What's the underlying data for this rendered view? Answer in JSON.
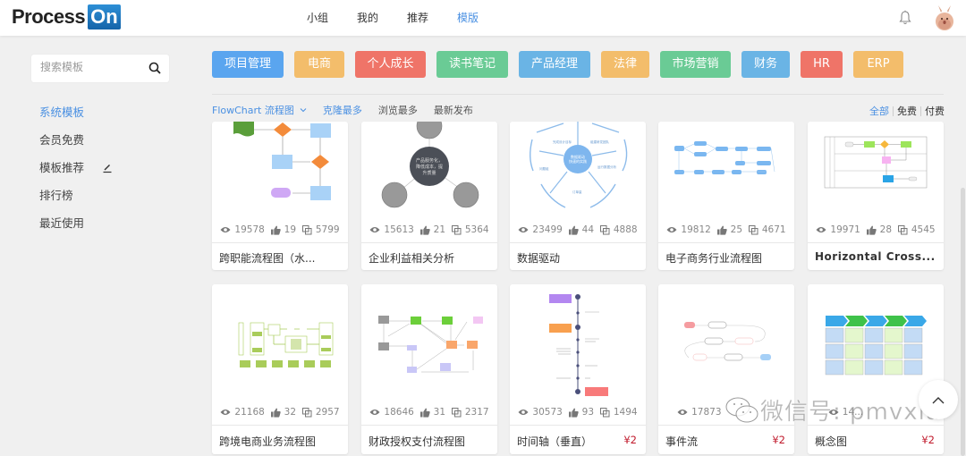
{
  "app": {
    "logo_word": "Process",
    "logo_on": "On"
  },
  "nav": [
    {
      "label": "小组",
      "active": false
    },
    {
      "label": "我的",
      "active": false
    },
    {
      "label": "推荐",
      "active": false
    },
    {
      "label": "模版",
      "active": true
    }
  ],
  "header_icons": {
    "notification": "bell-icon",
    "avatar": "user-avatar"
  },
  "search": {
    "placeholder": "搜索模板",
    "value": "",
    "icon": "search-icon"
  },
  "sidebar": {
    "items": [
      {
        "label": "系统模板",
        "active": true
      },
      {
        "label": "会员免费",
        "active": false
      },
      {
        "label": "模板推荐",
        "active": false,
        "icon": "edit-pen-icon"
      },
      {
        "label": "排行榜",
        "active": false
      },
      {
        "label": "最近使用",
        "active": false
      }
    ]
  },
  "categories": [
    {
      "label": "项目管理",
      "color": "#5aa5ef"
    },
    {
      "label": "电商",
      "color": "#f3bd6b"
    },
    {
      "label": "个人成长",
      "color": "#ef7468"
    },
    {
      "label": "读书笔记",
      "color": "#6acb95"
    },
    {
      "label": "产品经理",
      "color": "#6ab4e5"
    },
    {
      "label": "法律",
      "color": "#f3bd6b"
    },
    {
      "label": "市场营销",
      "color": "#6acb95"
    },
    {
      "label": "财务",
      "color": "#6ab4e5"
    },
    {
      "label": "HR",
      "color": "#ef7468"
    },
    {
      "label": "ERP",
      "color": "#f3bd6b"
    }
  ],
  "filters": {
    "type_label": "FlowChart 流程图",
    "sort": [
      {
        "label": "克隆最多",
        "active": true
      },
      {
        "label": "浏览最多",
        "active": false
      },
      {
        "label": "最新发布",
        "active": false
      }
    ],
    "price": [
      {
        "label": "全部",
        "active": true
      },
      {
        "label": "免费",
        "active": false
      },
      {
        "label": "付费",
        "active": false
      }
    ]
  },
  "templates": [
    {
      "title": "跨职能流程图（水...",
      "views": "19578",
      "likes": "19",
      "clones": "5799",
      "price": ""
    },
    {
      "title": "企业利益相关分析",
      "views": "15613",
      "likes": "21",
      "clones": "5364",
      "price": ""
    },
    {
      "title": "数据驱动",
      "views": "23499",
      "likes": "44",
      "clones": "4888",
      "price": ""
    },
    {
      "title": "电子商务行业流程图",
      "views": "19812",
      "likes": "25",
      "clones": "4671",
      "price": ""
    },
    {
      "title": "Horizontal Cross...",
      "views": "19971",
      "likes": "28",
      "clones": "4545",
      "price": ""
    },
    {
      "title": "跨境电商业务流程图",
      "views": "21168",
      "likes": "32",
      "clones": "2957",
      "price": ""
    },
    {
      "title": "财政授权支付流程图",
      "views": "18646",
      "likes": "31",
      "clones": "2317",
      "price": ""
    },
    {
      "title": "时间轴（垂直）",
      "views": "30573",
      "likes": "93",
      "clones": "1494",
      "price": "¥2"
    },
    {
      "title": "事件流",
      "views": "17873",
      "likes": "",
      "clones": "",
      "price": "¥2"
    },
    {
      "title": "概念图",
      "views": "14...",
      "likes": "",
      "clones": "",
      "price": "¥2"
    }
  ],
  "back_to_top": "chevron-up-icon",
  "watermark": "微信号: pmvxia"
}
